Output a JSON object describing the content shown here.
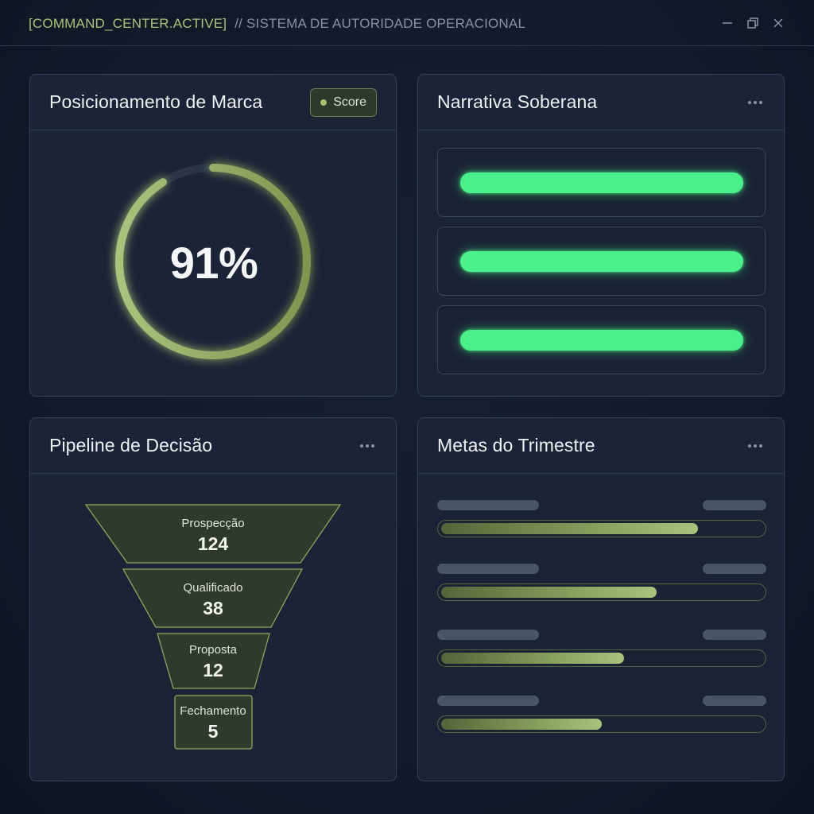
{
  "titlebar": {
    "status_tag": "[COMMAND_CENTER.ACTIVE]",
    "system_name": "// SISTEMA DE AUTORIDADE OPERACIONAL",
    "controls": [
      "minimize-icon",
      "restore-icon",
      "close-icon"
    ]
  },
  "brand": {
    "title": "Posicionamento de Marca",
    "badge_label": "Score",
    "score_value": "91%",
    "score_fraction": 0.91
  },
  "narrative": {
    "title": "Narrativa Soberana",
    "bars": [
      1.0,
      1.0,
      1.0
    ]
  },
  "pipeline": {
    "title": "Pipeline de Decisão",
    "stages": [
      {
        "label": "Prospecção",
        "value": "124"
      },
      {
        "label": "Qualificado",
        "value": "38"
      },
      {
        "label": "Proposta",
        "value": "12"
      },
      {
        "label": "Fechamento",
        "value": "5"
      }
    ]
  },
  "goals": {
    "title": "Metas do Trimestre",
    "progress": [
      0.8,
      0.67,
      0.57,
      0.5
    ]
  },
  "colors": {
    "accent_olive": "#a8c47a",
    "neon_green": "#4cf08a",
    "panel_bg": "#1b2436",
    "page_bg": "#111827"
  }
}
